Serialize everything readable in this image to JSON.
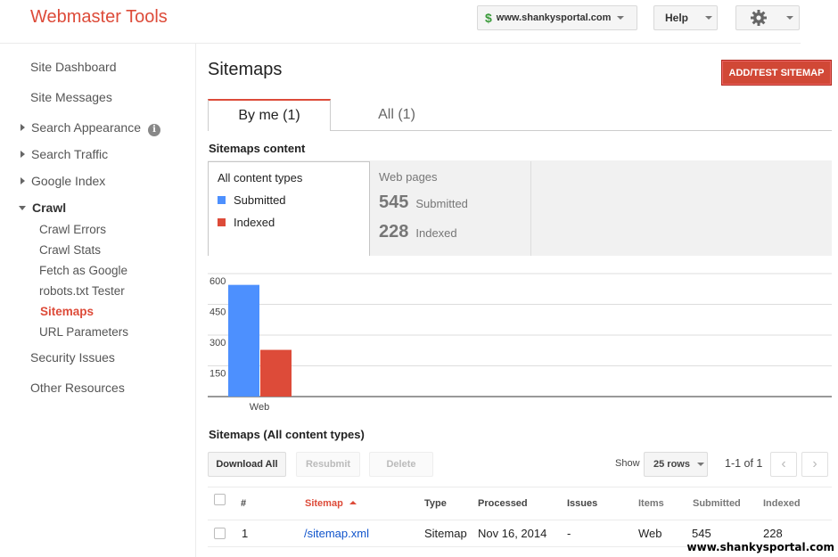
{
  "header": {
    "logo": "Webmaster Tools",
    "site_icon": "dollar-sign-icon",
    "site": "www.shankysportal.com",
    "help": "Help",
    "settings_icon": "gear-icon"
  },
  "sidebar": {
    "items": [
      {
        "label": "Site Dashboard"
      },
      {
        "label": "Site Messages"
      },
      {
        "label": "Search Appearance",
        "info_icon": "i"
      },
      {
        "label": "Search Traffic"
      },
      {
        "label": "Google Index"
      },
      {
        "label": "Crawl"
      },
      {
        "label": "Crawl Errors"
      },
      {
        "label": "Crawl Stats"
      },
      {
        "label": "Fetch as Google"
      },
      {
        "label": "robots.txt Tester"
      },
      {
        "label": "Sitemaps"
      },
      {
        "label": "URL Parameters"
      },
      {
        "label": "Security Issues"
      },
      {
        "label": "Other Resources"
      }
    ]
  },
  "main": {
    "title": "Sitemaps",
    "add_button": "ADD/TEST SITEMAP",
    "tabs": [
      {
        "label": "By me (1)"
      },
      {
        "label": "All (1)"
      }
    ],
    "content_heading": "Sitemaps content",
    "legend": {
      "all_types": "All content types",
      "submitted": "Submitted",
      "indexed": "Indexed"
    },
    "web": {
      "title": "Web pages",
      "submitted_num": "545",
      "submitted_label": "Submitted",
      "indexed_num": "228",
      "indexed_label": "Indexed"
    },
    "table_heading": "Sitemaps (All content types)",
    "toolbar": {
      "download": "Download All",
      "resubmit": "Resubmit",
      "delete": "Delete",
      "show": "Show",
      "rows": "25 rows",
      "pagination": "1-1 of 1",
      "prev": "‹",
      "next": "›"
    },
    "columns": [
      "#",
      "Sitemap",
      "Type",
      "Processed",
      "Issues",
      "Items",
      "Submitted",
      "Indexed"
    ],
    "rows": [
      {
        "num": "1",
        "sitemap": "/sitemap.xml",
        "type": "Sitemap",
        "processed": "Nov 16, 2014",
        "issues": "-",
        "items": "Web",
        "submitted": "545",
        "indexed": "228"
      }
    ]
  },
  "colors": {
    "submitted": "#4d90fe",
    "indexed": "#dd4b39",
    "brand": "#dd4b39"
  },
  "chart_data": {
    "type": "bar",
    "categories": [
      "Web"
    ],
    "series": [
      {
        "name": "Submitted",
        "values": [
          545
        ]
      },
      {
        "name": "Indexed",
        "values": [
          228
        ]
      }
    ],
    "yticks": [
      "150",
      "300",
      "450",
      "600"
    ],
    "ylim": [
      0,
      600
    ],
    "grid": true
  },
  "watermark": "www.shankysportal.com"
}
